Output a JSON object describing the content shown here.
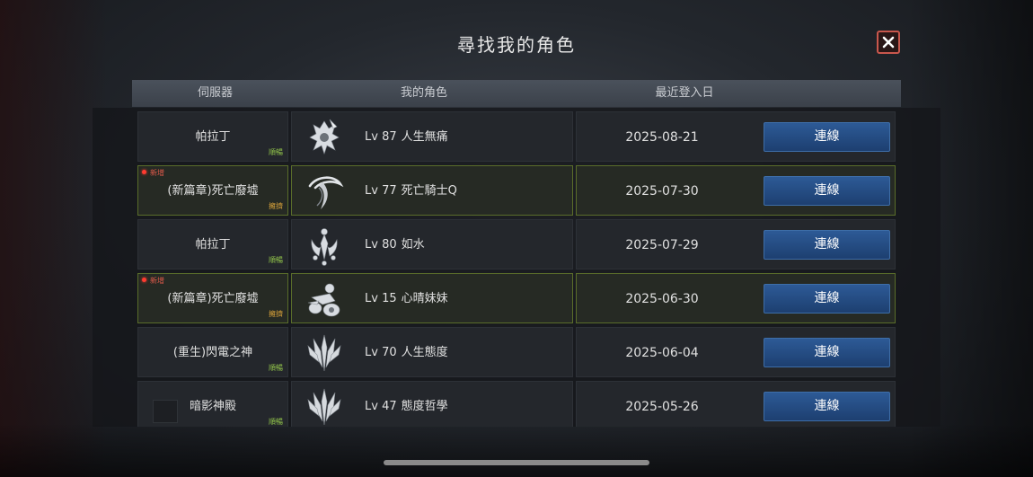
{
  "dialog": {
    "title": "尋找我的角色",
    "close_icon": "close-x-icon"
  },
  "columns": {
    "server": "伺服器",
    "character": "我的角色",
    "last_login": "最近登入日"
  },
  "rows": [
    {
      "server": "帕拉丁",
      "server_tag": "順暢",
      "is_new": false,
      "new_label": "",
      "level": "Lv 87",
      "name": "人生無痛",
      "class_icon": "dark-knight-class-icon",
      "date": "2025-08-21",
      "button": "連線"
    },
    {
      "server": "(新篇章)死亡廢墟",
      "server_tag": "擁擠",
      "is_new": true,
      "new_label": "新增",
      "level": "Lv 77",
      "name": "死亡騎士Q",
      "class_icon": "reaper-class-icon",
      "date": "2025-07-30",
      "button": "連線"
    },
    {
      "server": "帕拉丁",
      "server_tag": "順暢",
      "is_new": false,
      "new_label": "",
      "level": "Lv 80",
      "name": "如水",
      "class_icon": "priest-class-icon",
      "date": "2025-07-29",
      "button": "連線"
    },
    {
      "server": "(新篇章)死亡廢墟",
      "server_tag": "擁擠",
      "is_new": true,
      "new_label": "新增",
      "level": "Lv 15",
      "name": "心晴妹妹",
      "class_icon": "archer-class-icon",
      "date": "2025-06-30",
      "button": "連線"
    },
    {
      "server": "(重生)閃電之神",
      "server_tag": "順暢",
      "is_new": false,
      "new_label": "",
      "level": "Lv 70",
      "name": "人生態度",
      "class_icon": "warrior-class-icon",
      "date": "2025-06-04",
      "button": "連線"
    },
    {
      "server": "暗影神殿",
      "server_tag": "順暢",
      "is_new": false,
      "new_label": "",
      "level": "Lv 47",
      "name": "態度哲學",
      "class_icon": "warrior-class-icon",
      "date": "2025-05-26",
      "button": "連線"
    }
  ],
  "colors": {
    "accent_button": "#2d5a96",
    "new_border": "#5a6d2a",
    "status_smooth": "#8fc04a",
    "status_busy": "#d9a23a",
    "new_badge": "#ff3b30",
    "close_border": "#c9574d"
  }
}
